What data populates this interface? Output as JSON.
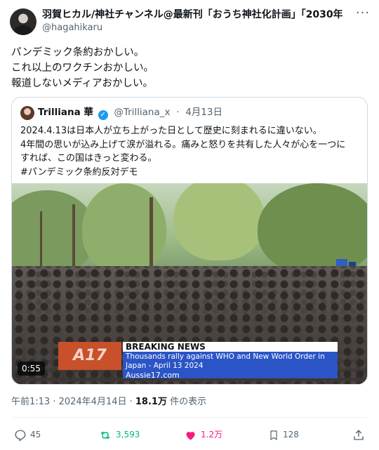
{
  "author": {
    "display_name": "羽賀ヒカル/神社チャンネル@最新刊「おうち神社化計画」「2030年大",
    "handle": "@hagahikaru"
  },
  "tweet": {
    "lines": [
      "パンデミック条約おかしい。",
      "これ以上のワクチンおかしい。",
      "報道しないメディアおかしい。"
    ]
  },
  "quote": {
    "name": "Trilliana 華",
    "handle": "@Trilliana_x",
    "date": "4月13日",
    "lines": [
      "2024.4.13は日本人が立ち上がった日として歴史に刻まれるに違いない。",
      "4年間の思いが込み上げて涙が溢れる。痛みと怒りを共有した人々が心を一つに",
      "すれば、この国はきっと変わる。",
      "#パンデミック条約反対デモ"
    ],
    "video": {
      "logo_text": "A17",
      "breaking_label": "BREAKING NEWS",
      "headline_1": "Thousands rally against WHO and New World Order in",
      "headline_2": "Japan - April 13 2024",
      "source": "Aussie17.com",
      "duration": "0:55"
    }
  },
  "meta": {
    "time_date": "午前1:13 · 2024年4月14日 · ",
    "views_count": "18.1万",
    "views_suffix": " 件の表示"
  },
  "actions": {
    "replies": "45",
    "reposts": "3,593",
    "likes": "1.2万",
    "bookmarks": "128"
  },
  "colors": {
    "verified": "#1d9bf0",
    "repost": "#00ba7c",
    "like": "#f91880",
    "secondary_text": "#536471"
  }
}
